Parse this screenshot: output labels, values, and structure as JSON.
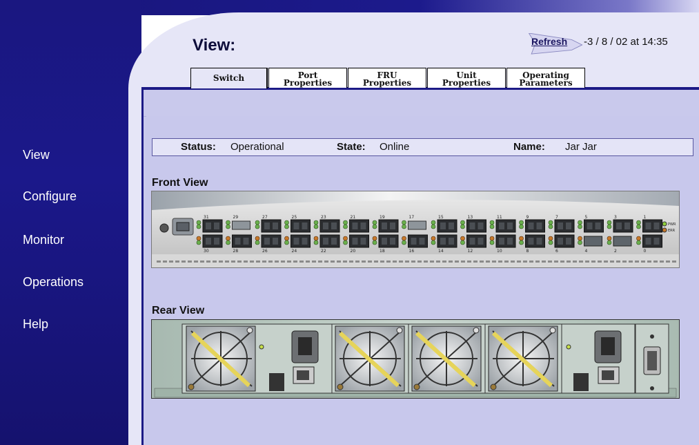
{
  "nav": {
    "items": [
      {
        "label": "View"
      },
      {
        "label": "Configure"
      },
      {
        "label": "Monitor"
      },
      {
        "label": "Operations"
      },
      {
        "label": "Help"
      }
    ]
  },
  "header": {
    "title": "View:",
    "refresh_label": "Refresh",
    "refresh_timestamp": "-3 / 8 / 02 at 14:35"
  },
  "tabs": [
    {
      "line1": "Switch",
      "line2": "",
      "active": true
    },
    {
      "line1": "Port",
      "line2": "Properties",
      "active": false
    },
    {
      "line1": "FRU",
      "line2": "Properties",
      "active": false
    },
    {
      "line1": "Unit",
      "line2": "Properties",
      "active": false
    },
    {
      "line1": "Operating",
      "line2": "Parameters",
      "active": false
    }
  ],
  "status": {
    "status_label": "Status:",
    "status_value": "Operational",
    "state_label": "State:",
    "state_value": "Online",
    "name_label": "Name:",
    "name_value": "Jar Jar"
  },
  "front_view": {
    "label": "Front View",
    "top_port_numbers": [
      "31",
      "29",
      "27",
      "25",
      "23",
      "21",
      "19",
      "17",
      "15",
      "13",
      "11",
      "9",
      "7",
      "5",
      "3",
      "1"
    ],
    "bottom_port_numbers": [
      "30",
      "28",
      "26",
      "24",
      "22",
      "20",
      "18",
      "16",
      "14",
      "12",
      "10",
      "8",
      "6",
      "4",
      "2",
      "0"
    ],
    "pwr_label": "PWR",
    "err_label": "ERR"
  },
  "rear_view": {
    "label": "Rear View"
  },
  "colors": {
    "nav_bg": "#1b188a",
    "panel_bg": "#e6e6f7",
    "content_bg": "#c9c9ec",
    "accent": "#1c1a86"
  }
}
